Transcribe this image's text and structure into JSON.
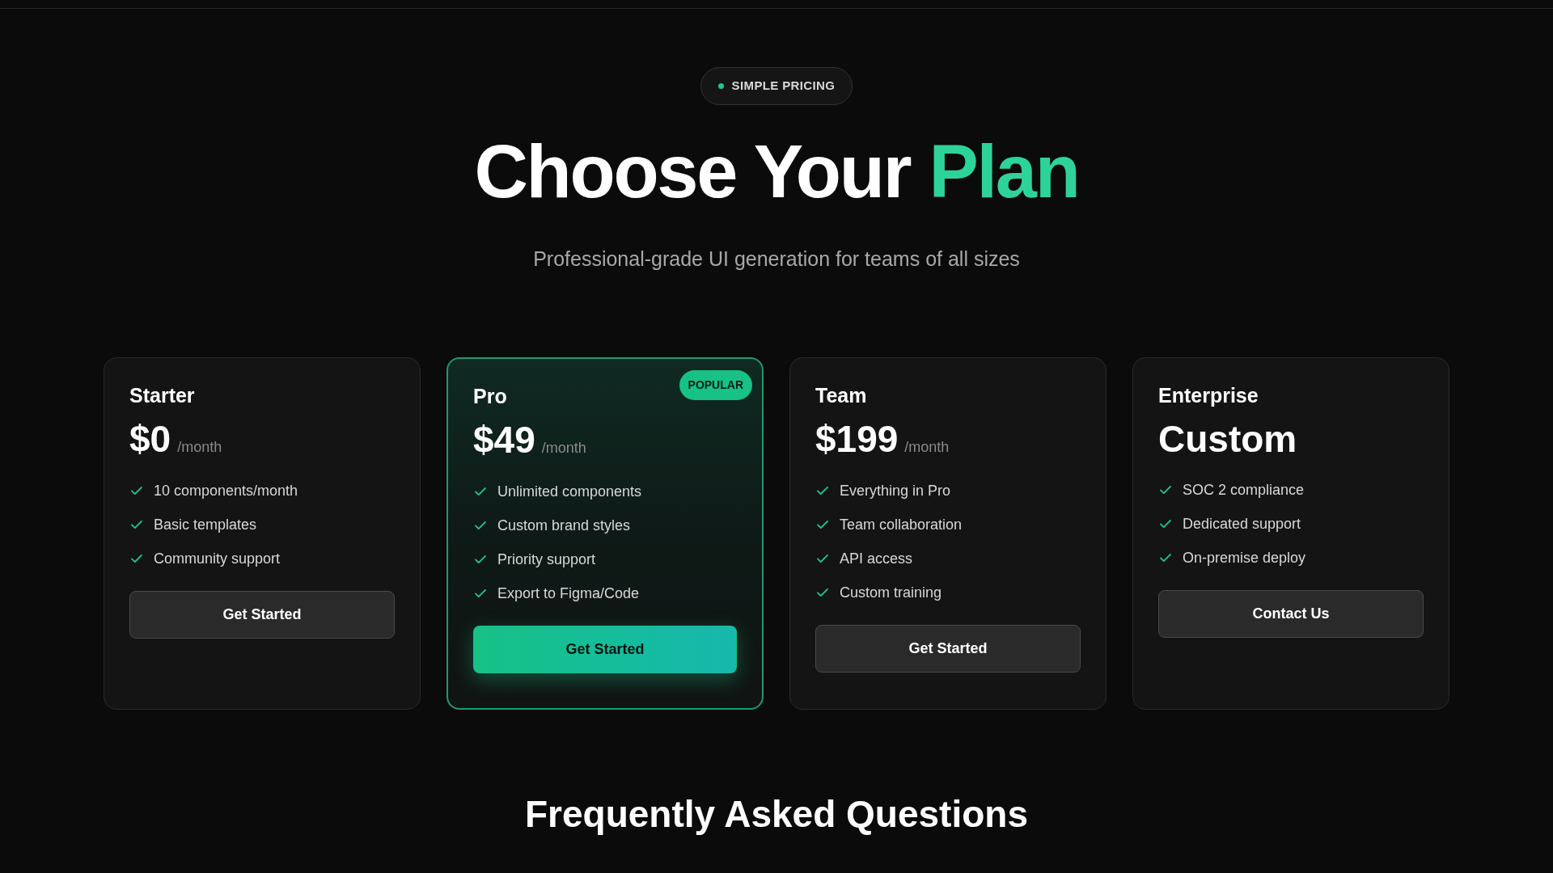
{
  "badge": {
    "label": "SIMPLE PRICING"
  },
  "heading": {
    "text": "Choose Your ",
    "accent": "Plan"
  },
  "subtitle": "Professional-grade UI generation for teams of all sizes",
  "plans": [
    {
      "name": "Starter",
      "price": "$0",
      "period": "/month",
      "highlighted": false,
      "features": [
        "10 components/month",
        "Basic templates",
        "Community support"
      ],
      "button": {
        "label": "Get Started",
        "kind": "secondary"
      }
    },
    {
      "name": "Pro",
      "price": "$49",
      "period": "/month",
      "highlighted": true,
      "tag": "POPULAR",
      "features": [
        "Unlimited components",
        "Custom brand styles",
        "Priority support",
        "Export to Figma/Code"
      ],
      "button": {
        "label": "Get Started",
        "kind": "primary"
      }
    },
    {
      "name": "Team",
      "price": "$199",
      "period": "/month",
      "highlighted": false,
      "features": [
        "Everything in Pro",
        "Team collaboration",
        "API access",
        "Custom training"
      ],
      "button": {
        "label": "Get Started",
        "kind": "secondary"
      }
    },
    {
      "name": "Enterprise",
      "price": "Custom",
      "highlighted": false,
      "features": [
        "SOC 2 compliance",
        "Dedicated support",
        "On-premise deploy"
      ],
      "button": {
        "label": "Contact Us",
        "kind": "secondary"
      }
    }
  ],
  "faq": {
    "title": "Frequently Asked Questions"
  }
}
